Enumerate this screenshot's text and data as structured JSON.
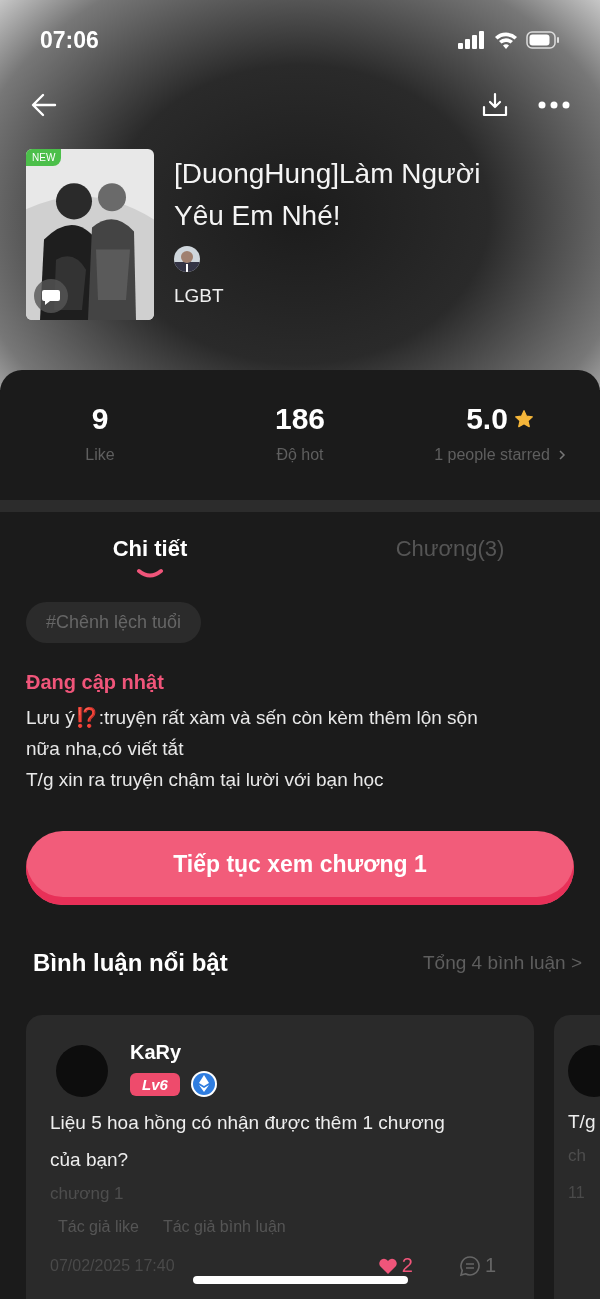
{
  "status_bar": {
    "time": "07:06"
  },
  "book": {
    "badge": "NEW",
    "title": "[DuongHung]Làm Người Yêu Em Nhé!",
    "category": "LGBT"
  },
  "stats": [
    {
      "value": "9",
      "label": "Like",
      "kind": "plain"
    },
    {
      "value": "186",
      "label": "Độ hot",
      "kind": "plain"
    },
    {
      "value": "5.0",
      "label": "1 people starred",
      "kind": "rating"
    }
  ],
  "tabs": [
    {
      "label": "Chi tiết",
      "selected": true
    },
    {
      "label": "Chương(3)",
      "selected": false
    }
  ],
  "tags": [
    "#Chênh lệch tuổi"
  ],
  "status": "Đang cập nhật",
  "description": [
    "Lưu ý⁉️:truyện rất xàm và sến còn kèm thêm lộn sộn nữa nha,có viết tắt",
    "T/g xin ra truyện chậm tại lười với bạn học"
  ],
  "continue_button": "Tiếp tục xem chương 1",
  "comments_section": {
    "title": "Bình luận nổi bật",
    "total": "Tổng 4 bình luận >"
  },
  "comments": [
    {
      "user": "KaRy",
      "level": "Lv6",
      "text": "Liệu 5 hoa hồng có nhận được thêm 1 chương của bạn?",
      "chapter": "chương 1",
      "author_actions": [
        "Tác giả like",
        "Tác giả bình luận"
      ],
      "date": "07/02/2025 17:40",
      "likes": "2",
      "replies": "1"
    },
    {
      "text": "T/g",
      "chapter": "ch",
      "date": "11"
    }
  ]
}
